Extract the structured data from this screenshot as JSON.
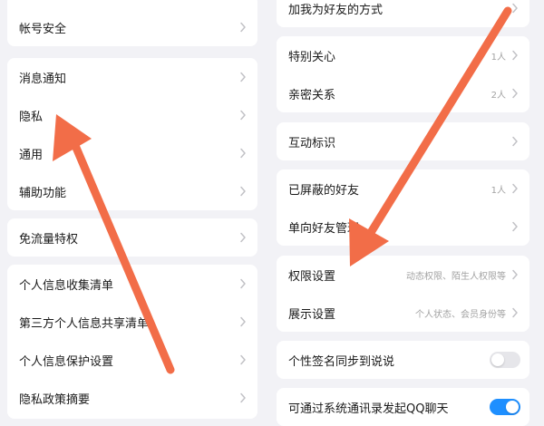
{
  "left": {
    "account_security": "帐号安全",
    "notifications": "消息通知",
    "privacy": "隐私",
    "general": "通用",
    "accessibility": "辅助功能",
    "free_data": "免流量特权",
    "personal_info_list": "个人信息收集清单",
    "third_party_list": "第三方个人信息共享清单",
    "info_protection": "个人信息保护设置",
    "privacy_summary": "隐私政策摘要"
  },
  "right": {
    "add_friend_method": "加我为好友的方式",
    "special_care": "特别关心",
    "special_care_count": "1人",
    "intimate": "亲密关系",
    "intimate_count": "2人",
    "interaction_marks": "互动标识",
    "blocked_friends": "已屏蔽的好友",
    "blocked_count": "1人",
    "one_way_friends": "单向好友管理",
    "permission_settings": "权限设置",
    "permission_desc": "动态权限、陌生人权限等",
    "display_settings": "展示设置",
    "display_desc": "个人状态、会员身份等",
    "signature_sync": "个性签名同步到说说",
    "contacts_chat": "可通过系统通讯录发起QQ聊天"
  },
  "toggles": {
    "signature_sync_on": false,
    "contacts_chat_on": true
  },
  "colors": {
    "background": "#f2f2f6",
    "card": "#ffffff",
    "annotation_arrow": "#f26d48",
    "toggle_on": "#1e8fff",
    "toggle_off": "#e6e6ea"
  }
}
